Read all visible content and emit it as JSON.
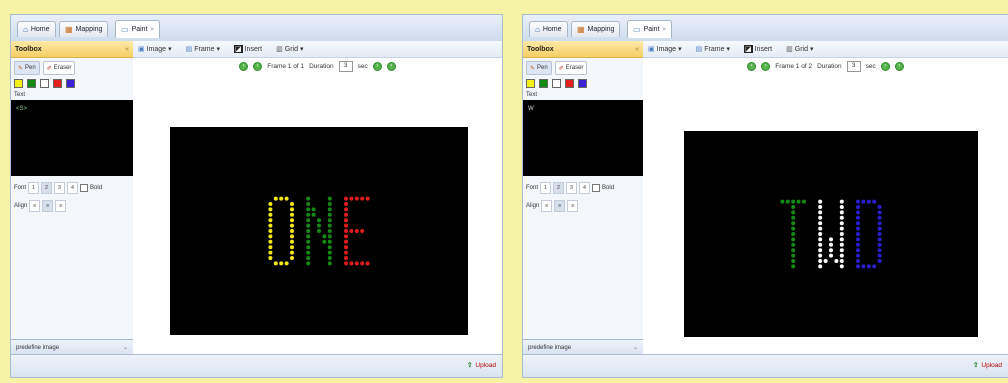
{
  "colors": {
    "yellow": "#f5e51b",
    "green": "#138a13",
    "red": "#e11d1d",
    "white": "#ffffff",
    "blue": "#2a1ed1"
  },
  "panels": [
    {
      "tabs": [
        {
          "label": "Home",
          "icon": "home-icon"
        },
        {
          "label": "Mapping",
          "icon": "mapping-icon"
        },
        {
          "label": "Paint",
          "icon": "paint-icon",
          "active": true
        }
      ],
      "toolbox": {
        "title": "Toolbox",
        "pen_label": "Pen",
        "eraser_label": "Eraser",
        "swatches": [
          "#f2ef1b",
          "#138a13",
          "#ffffff",
          "#e11d1d",
          "#3a22d4"
        ],
        "text_label": "Text",
        "text_value": "<S>",
        "font_label": "Font",
        "font_sizes": [
          "1",
          "2",
          "3",
          "4"
        ],
        "bold_label": "Bold",
        "align_label": "Align",
        "predefine_label": "predefine image"
      },
      "menu": {
        "image": "Image",
        "frame": "Frame",
        "insert": "Insert",
        "grid": "Grid"
      },
      "frame_bar": {
        "frame_text": "Frame 1 of 1",
        "duration_label": "Duration",
        "duration_value": "3",
        "sec_label": "sec"
      },
      "display_text": "ONE",
      "letter_colors": [
        "yellow",
        "green",
        "red"
      ],
      "upload_label": "Upload"
    },
    {
      "tabs": [
        {
          "label": "Home",
          "icon": "home-icon"
        },
        {
          "label": "Mapping",
          "icon": "mapping-icon"
        },
        {
          "label": "Paint",
          "icon": "paint-icon",
          "active": true
        }
      ],
      "toolbox": {
        "title": "Toolbox",
        "pen_label": "Pen",
        "eraser_label": "Eraser",
        "swatches": [
          "#f2ef1b",
          "#138a13",
          "#ffffff",
          "#e11d1d",
          "#3a22d4"
        ],
        "text_label": "Text",
        "text_value": "W",
        "font_label": "Font",
        "font_sizes": [
          "1",
          "2",
          "3",
          "4"
        ],
        "bold_label": "Bold",
        "align_label": "Align",
        "predefine_label": "predefine image"
      },
      "menu": {
        "image": "Image",
        "frame": "Frame",
        "insert": "Insert",
        "grid": "Grid"
      },
      "frame_bar": {
        "frame_text": "Frame 1 of 2",
        "duration_label": "Duration",
        "duration_value": "3",
        "sec_label": "sec"
      },
      "display_text": "TWD",
      "letter_colors": [
        "green",
        "white",
        "blue"
      ],
      "upload_label": "Upload"
    }
  ]
}
